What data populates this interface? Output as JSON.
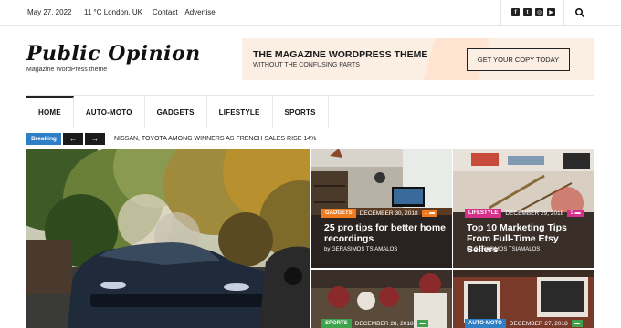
{
  "topbar": {
    "date": "May 27, 2022",
    "weather": "11 °C London, UK",
    "links": [
      "Contact",
      "Advertise"
    ],
    "social_icons": [
      "facebook-icon",
      "twitter-icon",
      "instagram-icon",
      "youtube-icon"
    ]
  },
  "header": {
    "logo": "Public Opinion",
    "tagline": "Magazine WordPress theme"
  },
  "banner": {
    "title": "THE MAGAZINE WORDPRESS THEME",
    "subtitle": "WITHOUT THE CONFUSING PARTS",
    "cta": "GET YOUR COPY TODAY"
  },
  "nav": {
    "items": [
      "HOME",
      "AUTO-MOTO",
      "GADGETS",
      "LIFESTYLE",
      "SPORTS"
    ]
  },
  "breaking": {
    "label": "Breaking",
    "prev": "←",
    "next": "→",
    "headline": "NISSAN, TOYOTA AMONG WINNERS AS FRENCH SALES RISE 14%"
  },
  "posts": [
    {
      "category": "GADGETS",
      "date": "DECEMBER 30, 2018",
      "comments": "1",
      "title": "25 pro tips for better home recordings",
      "author_prefix": "by",
      "author": "GERASIMOS TSIAMALOS",
      "cat_color": "#f07a20"
    },
    {
      "category": "LIFESTYLE",
      "date": "DECEMBER 29, 2018",
      "comments": "1",
      "title": "Top 10 Marketing Tips From Full-Time Etsy Sellers",
      "author_prefix": "by",
      "author": "GERASIMOS TSIAMALOS",
      "cat_color": "#d6308a"
    },
    {
      "category": "SPORTS",
      "date": "DECEMBER 28, 2018",
      "comments": "",
      "cat_color": "#3fa34d"
    },
    {
      "category": "AUTO-MOTO",
      "date": "DECEMBER 27, 2018",
      "comments": "",
      "cat_color": "#2f7fc7"
    }
  ]
}
